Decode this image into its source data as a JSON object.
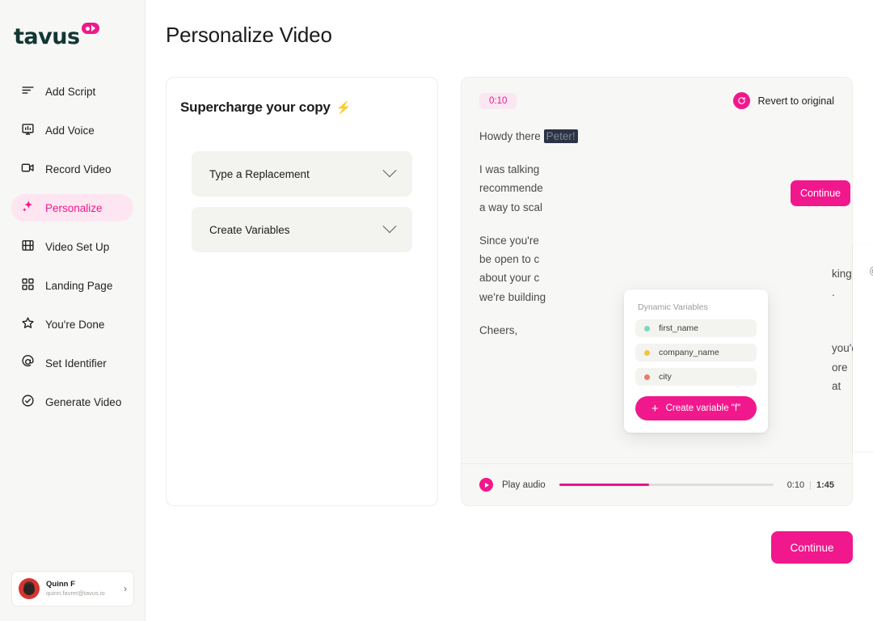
{
  "brand": {
    "logo_text": "tavus",
    "accent": "#f0188c",
    "accent_soft": "#fde6f2",
    "logo_color": "#123734"
  },
  "sidebar": {
    "items": [
      {
        "label": "Add Script",
        "icon": "lines-icon",
        "active": false
      },
      {
        "label": "Add Voice",
        "icon": "waveform-icon",
        "active": false
      },
      {
        "label": "Record Video",
        "icon": "video-camera-icon",
        "active": false
      },
      {
        "label": "Personalize",
        "icon": "sparkles-icon",
        "active": true
      },
      {
        "label": "Video Set Up",
        "icon": "film-icon",
        "active": false
      },
      {
        "label": "Landing Page",
        "icon": "grid-icon",
        "active": false
      },
      {
        "label": "You're Done",
        "icon": "star-icon",
        "active": false
      },
      {
        "label": "Set Identifier",
        "icon": "at-icon",
        "active": false
      },
      {
        "label": "Generate Video",
        "icon": "check-circle-icon",
        "active": false
      }
    ],
    "user": {
      "name": "Quinn F",
      "email": "quinn.favret@tavus.io"
    }
  },
  "header": {
    "title": "Personalize Video"
  },
  "left_panel": {
    "title": "Supercharge your copy",
    "title_emoji": "⚡",
    "accordions": [
      {
        "label": "Type a Replacement"
      },
      {
        "label": "Create Variables"
      }
    ]
  },
  "right_panel": {
    "duration_pill": "0:10",
    "revert_label": "Revert to original",
    "script": {
      "greeting_prefix": "Howdy there",
      "greeting_name": "Peter!",
      "paragraph_2_line_1": "I was talking",
      "paragraph_2_line_1_tail": "king for",
      "paragraph_2_line_2": "recommende",
      "paragraph_2_line_2_tail": ".",
      "paragraph_2_line_3": "a way to scal",
      "paragraph_3_line_1": "Since you're",
      "paragraph_3_line_1_tail": "you'd",
      "paragraph_3_line_2": "be open to c",
      "paragraph_3_line_2_tail": "ore",
      "paragraph_3_line_3": "about your c",
      "paragraph_3_line_3_tail": "at",
      "paragraph_3_line_4": "we're building",
      "signoff": "Cheers,"
    },
    "player": {
      "play_label": "Play audio",
      "current_time": "0:10",
      "separator": "|",
      "total_time": "1:45",
      "progress_percent": 42
    }
  },
  "mention_overlay": {
    "input_value": "@f",
    "continue_label": "Continue",
    "variables_popup": {
      "title": "Dynamic Variables",
      "items": [
        {
          "name": "first_name",
          "dot_color": "#7fd6c0"
        },
        {
          "name": "company_name",
          "dot_color": "#f5c542"
        },
        {
          "name": "city",
          "dot_color": "#e87b6a"
        }
      ],
      "create_label": "Create variable \"f\"",
      "create_icon": "plus-icon"
    }
  },
  "footer": {
    "continue_label": "Continue"
  }
}
